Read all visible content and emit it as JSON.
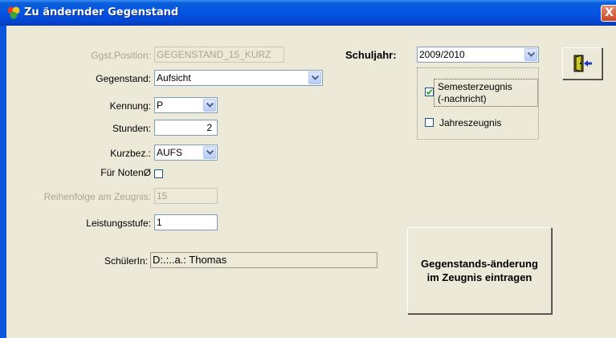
{
  "window": {
    "title": "Zu ändernder Gegenstand",
    "close_label": "X"
  },
  "form": {
    "position": {
      "label": "Ggst.Position:",
      "value": "GEGENSTAND_15_KURZ"
    },
    "gegenstand": {
      "label": "Gegenstand:",
      "value": "Aufsicht"
    },
    "kennung": {
      "label": "Kennung:",
      "value": "P"
    },
    "stunden": {
      "label": "Stunden:",
      "value": "2"
    },
    "kurzbez": {
      "label": "Kurzbez.:",
      "value": "AUFS"
    },
    "fuer_noten": {
      "label": "Für NotenØ",
      "checked": false
    },
    "reihenfolge": {
      "label": "Reihenfolge am Zeugnis:",
      "value": "15"
    },
    "leistungsstufe": {
      "label": "Leistungsstufe:",
      "value": "1"
    },
    "schueler": {
      "label": "SchülerIn:",
      "value": "D:.:..a.: Thomas"
    }
  },
  "schuljahr": {
    "label": "Schuljahr:",
    "value": "2009/2010"
  },
  "zeugnis": {
    "semester": {
      "label_line1": "Semesterzeugnis",
      "label_line2": "(-nachricht)",
      "checked": true
    },
    "jahres": {
      "label": "Jahreszeugnis",
      "checked": false
    }
  },
  "buttons": {
    "submit_label": "Gegenstands-änderung im Zeugnis eintragen",
    "exit_icon": "exit-door-icon"
  }
}
